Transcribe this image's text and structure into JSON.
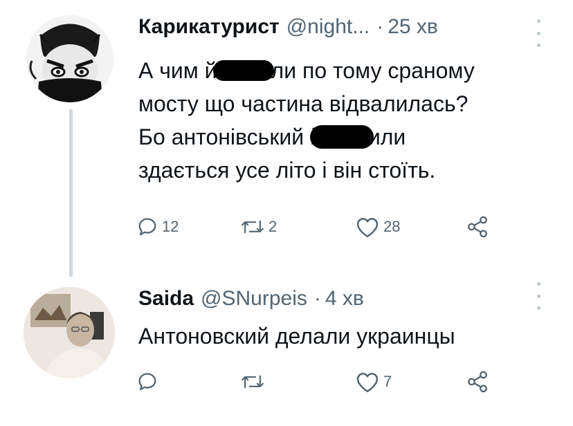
{
  "tweets": [
    {
      "author": {
        "name": "Карикатурист",
        "handle": "@night...",
        "separator": "·",
        "time": "25 хв"
      },
      "lines": [
        {
          "before": "А чим й",
          "after": "ли по тому сраному"
        },
        {
          "before": "мосту що частина відвалилась?",
          "after": ""
        },
        {
          "before": "Бо антонівський й",
          "after": "или"
        },
        {
          "before": "здається усе літо і він стоїть.",
          "after": ""
        }
      ],
      "actions": {
        "reply": "12",
        "retweet": "2",
        "like": "28"
      }
    },
    {
      "author": {
        "name": "Saida",
        "handle": "@SNurpeis",
        "separator": "·",
        "time": "4 хв"
      },
      "lines": [
        {
          "before": "Антоновский делали украинцы",
          "after": ""
        }
      ],
      "actions": {
        "reply": "",
        "retweet": "",
        "like": "7"
      }
    }
  ],
  "colors": {
    "text": "#0f1419",
    "secondary": "#536471",
    "thread_line": "#cfd9de"
  },
  "icons": [
    "reply-icon",
    "retweet-icon",
    "like-icon",
    "share-icon",
    "more-icon"
  ]
}
